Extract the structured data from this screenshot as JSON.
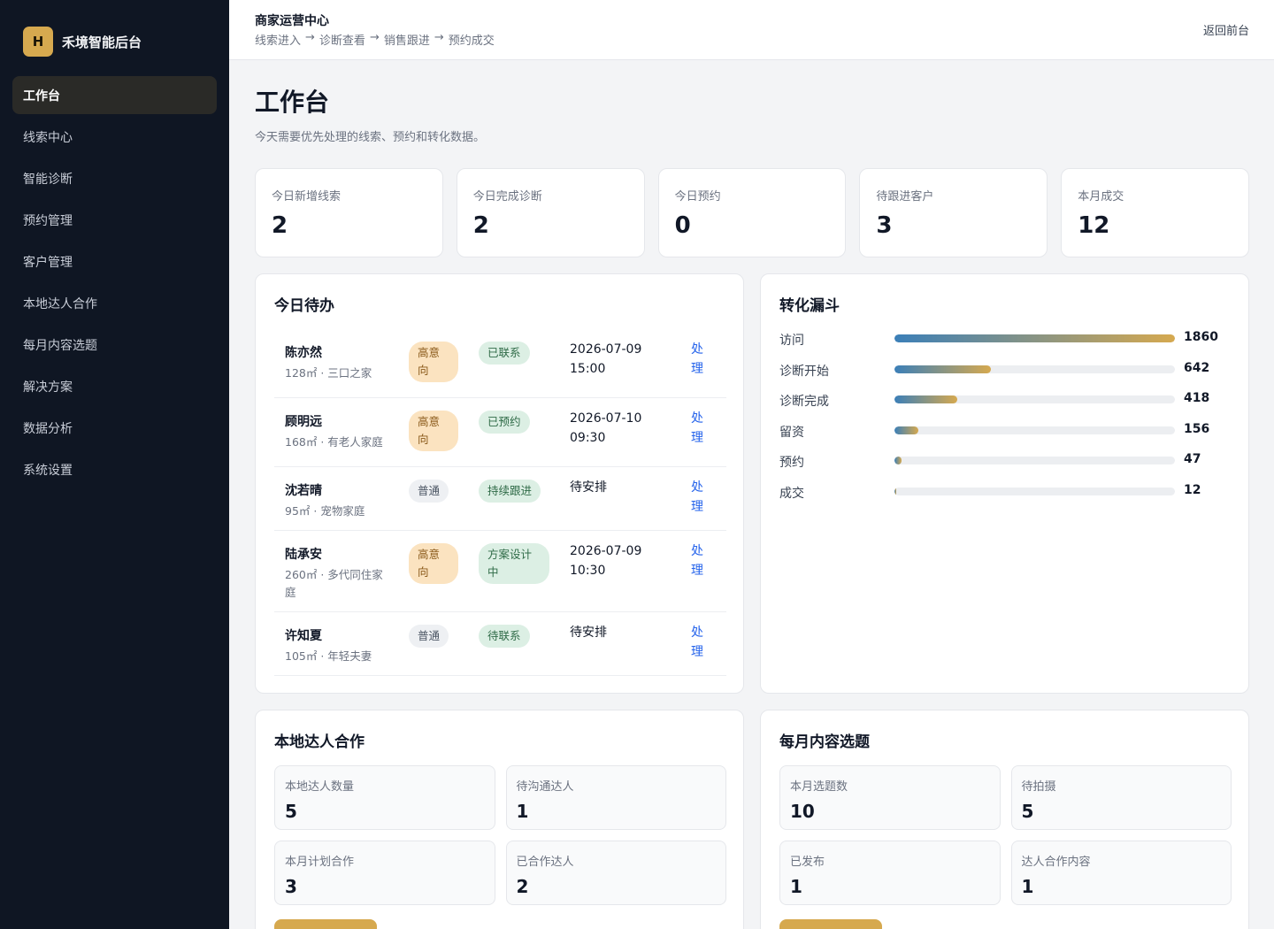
{
  "sidebar": {
    "logo_letter": "H",
    "brand": "禾境智能后台",
    "items": [
      {
        "label": "工作台",
        "active": true
      },
      {
        "label": "线索中心"
      },
      {
        "label": "智能诊断"
      },
      {
        "label": "预约管理"
      },
      {
        "label": "客户管理"
      },
      {
        "label": "本地达人合作"
      },
      {
        "label": "每月内容选题"
      },
      {
        "label": "解决方案"
      },
      {
        "label": "数据分析"
      },
      {
        "label": "系统设置"
      }
    ]
  },
  "topbar": {
    "title": "商家运营中心",
    "breadcrumb": [
      "线索进入",
      "诊断查看",
      "销售跟进",
      "预约成交"
    ],
    "separator": "→",
    "back": "返回前台"
  },
  "page": {
    "title": "工作台",
    "subtitle": "今天需要优先处理的线索、预约和转化数据。"
  },
  "stats": [
    {
      "label": "今日新增线索",
      "value": "2"
    },
    {
      "label": "今日完成诊断",
      "value": "2"
    },
    {
      "label": "今日预约",
      "value": "0"
    },
    {
      "label": "待跟进客户",
      "value": "3"
    },
    {
      "label": "本月成交",
      "value": "12"
    }
  ],
  "todo": {
    "title": "今日待办",
    "rows": [
      {
        "name": "陈亦然",
        "desc": "128㎡ · 三口之家",
        "level": "高意向",
        "level_type": "high",
        "status": "已联系",
        "time": "2026-07-09 15:00",
        "action": "处理"
      },
      {
        "name": "顾明远",
        "desc": "168㎡ · 有老人家庭",
        "level": "高意向",
        "level_type": "high",
        "status": "已预约",
        "time": "2026-07-10 09:30",
        "action": "处理"
      },
      {
        "name": "沈若晴",
        "desc": "95㎡ · 宠物家庭",
        "level": "普通",
        "level_type": "normal",
        "status": "持续跟进",
        "time": "待安排",
        "action": "处理"
      },
      {
        "name": "陆承安",
        "desc": "260㎡ · 多代同住家庭",
        "level": "高意向",
        "level_type": "high",
        "status": "方案设计中",
        "time": "2026-07-09 10:30",
        "action": "处理"
      },
      {
        "name": "许知夏",
        "desc": "105㎡ · 年轻夫妻",
        "level": "普通",
        "level_type": "normal",
        "status": "待联系",
        "time": "待安排",
        "action": "处理"
      }
    ]
  },
  "funnel": {
    "title": "转化漏斗",
    "max": 1860,
    "stages": [
      {
        "label": "访问",
        "value": 1860
      },
      {
        "label": "诊断开始",
        "value": 642
      },
      {
        "label": "诊断完成",
        "value": 418
      },
      {
        "label": "留资",
        "value": 156
      },
      {
        "label": "预约",
        "value": 47
      },
      {
        "label": "成交",
        "value": 12
      }
    ],
    "gradient": [
      "#3b7fb8",
      "#d6a94f"
    ]
  },
  "kol": {
    "title": "本地达人合作",
    "metrics": [
      {
        "label": "本地达人数量",
        "value": "5"
      },
      {
        "label": "待沟通达人",
        "value": "1"
      },
      {
        "label": "本月计划合作",
        "value": "3"
      },
      {
        "label": "已合作达人",
        "value": "2"
      }
    ]
  },
  "content": {
    "title": "每月内容选题",
    "metrics": [
      {
        "label": "本月选题数",
        "value": "10"
      },
      {
        "label": "待拍摄",
        "value": "5"
      },
      {
        "label": "已发布",
        "value": "1"
      },
      {
        "label": "达人合作内容",
        "value": "1"
      }
    ]
  },
  "colors": {
    "sidebar_bg": "#0f1623",
    "accent_gold": "#d6a94f",
    "link_blue": "#2563eb"
  }
}
